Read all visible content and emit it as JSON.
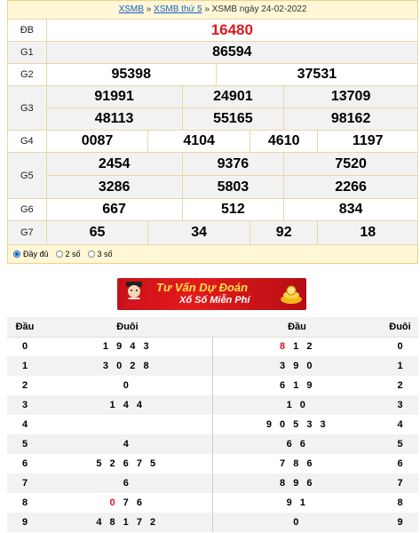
{
  "breadcrumb": {
    "link1": "XSMB",
    "sep1": "»",
    "link2": "XSMB thứ 5",
    "sep2": "»",
    "current": "XSMB ngày 24-02-2022"
  },
  "results": {
    "db_label": "ĐB",
    "db": "16480",
    "g1_label": "G1",
    "g1": "86594",
    "g2_label": "G2",
    "g2": [
      "95398",
      "37531"
    ],
    "g3_label": "G3",
    "g3": [
      "91991",
      "24901",
      "13709",
      "48113",
      "55165",
      "98162"
    ],
    "g4_label": "G4",
    "g4": [
      "0087",
      "4104",
      "4610",
      "1197"
    ],
    "g5_label": "G5",
    "g5": [
      "2454",
      "9376",
      "7520",
      "3286",
      "5803",
      "2266"
    ],
    "g6_label": "G6",
    "g6": [
      "667",
      "512",
      "834"
    ],
    "g7_label": "G7",
    "g7": [
      "65",
      "34",
      "92",
      "18"
    ]
  },
  "options": {
    "full": "Đầy đủ",
    "two": "2 số",
    "three": "3 số",
    "selected": "full"
  },
  "banner": {
    "line1": "Tư Vấn Dự Đoán",
    "line2": "Xổ Số Miễn Phí"
  },
  "loto": {
    "headers": {
      "dau": "Đầu",
      "duoi": "Đuôi",
      "dau2": "Đầu",
      "duoi2": "Đuôi"
    },
    "rows": [
      {
        "h": "0",
        "left_red": "",
        "left": "1 9 4 3",
        "right_red": "8",
        "right": " 1 2",
        "h2": "0"
      },
      {
        "h": "1",
        "left_red": "",
        "left": "3 0 2 8",
        "right_red": "",
        "right": "3 9 0",
        "h2": "1"
      },
      {
        "h": "2",
        "left_red": "",
        "left": "0",
        "right_red": "",
        "right": "6 1 9",
        "h2": "2"
      },
      {
        "h": "3",
        "left_red": "",
        "left": "1 4 4",
        "right_red": "",
        "right": "1 0",
        "h2": "3"
      },
      {
        "h": "4",
        "left_red": "",
        "left": "",
        "right_red": "",
        "right": "9 0 5 3 3",
        "h2": "4"
      },
      {
        "h": "5",
        "left_red": "",
        "left": "4",
        "right_red": "",
        "right": "6 6",
        "h2": "5"
      },
      {
        "h": "6",
        "left_red": "",
        "left": "5 2 6 7 5",
        "right_red": "",
        "right": "7 8 6",
        "h2": "6"
      },
      {
        "h": "7",
        "left_red": "",
        "left": "6",
        "right_red": "",
        "right": "8 9 6",
        "h2": "7"
      },
      {
        "h": "8",
        "left_red": "0",
        "left": " 7 6",
        "right_red": "",
        "right": "9 1",
        "h2": "8"
      },
      {
        "h": "9",
        "left_red": "",
        "left": "4 8 1 7 2",
        "right_red": "",
        "right": "0",
        "h2": "9"
      }
    ]
  }
}
